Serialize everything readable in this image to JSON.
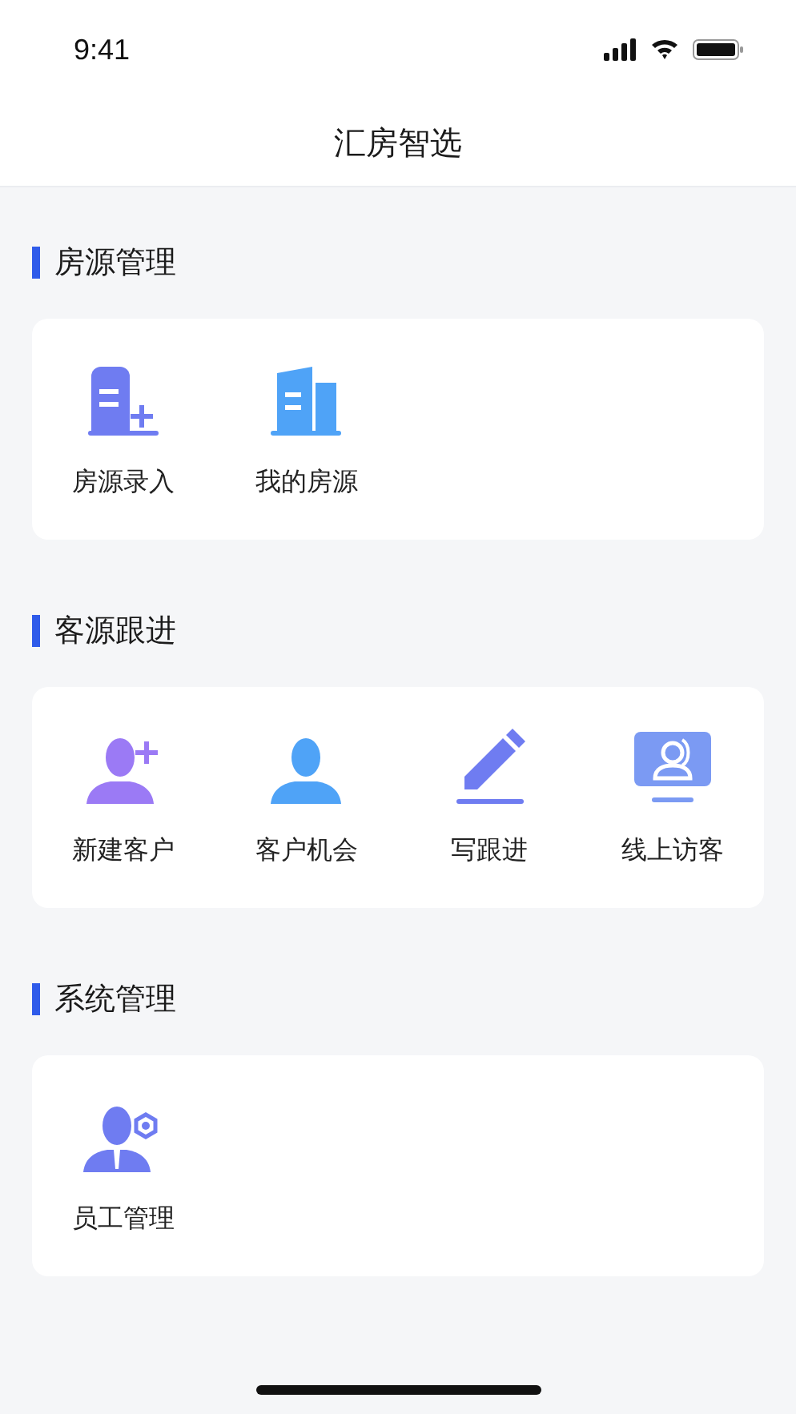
{
  "status_bar": {
    "time": "9:41"
  },
  "nav": {
    "title": "汇房智选"
  },
  "sections": [
    {
      "title": "房源管理",
      "items": [
        {
          "label": "房源录入",
          "kind": "building-add"
        },
        {
          "label": "我的房源",
          "kind": "buildings"
        }
      ]
    },
    {
      "title": "客源跟进",
      "items": [
        {
          "label": "新建客户",
          "kind": "person-add"
        },
        {
          "label": "客户机会",
          "kind": "person"
        },
        {
          "label": "写跟进",
          "kind": "pencil"
        },
        {
          "label": "线上访客",
          "kind": "monitor-person"
        }
      ]
    },
    {
      "title": "系统管理",
      "items": [
        {
          "label": "员工管理",
          "kind": "person-gear"
        }
      ]
    }
  ]
}
